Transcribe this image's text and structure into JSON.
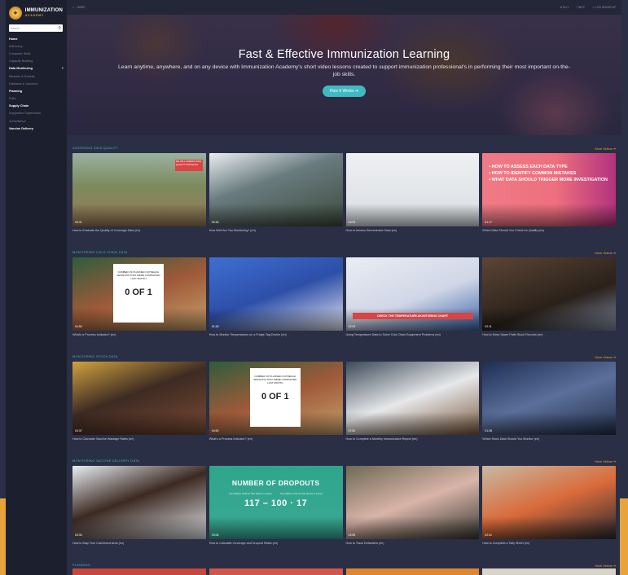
{
  "brand": {
    "name": "IMMUNIZATION",
    "sub": "ACADEMY"
  },
  "search": {
    "placeholder": "Search"
  },
  "nav": [
    {
      "label": "Home",
      "style": "bright"
    },
    {
      "label": "Advocacy",
      "style": "sub"
    },
    {
      "label": "Computer Skills",
      "style": "sub"
    },
    {
      "label": "Capacity Building",
      "style": "sub"
    },
    {
      "label": "Data Monitoring",
      "style": "bright",
      "plus": "+"
    },
    {
      "label": "Measles & Rubella",
      "style": "sub"
    },
    {
      "label": "Diseases & Vaccines",
      "style": "sub"
    },
    {
      "label": "Planning",
      "style": "bright"
    },
    {
      "label": "Polio",
      "style": "sub"
    },
    {
      "label": "Supply Chain",
      "style": "bright"
    },
    {
      "label": "Supportive Supervision",
      "style": "sub"
    },
    {
      "label": "Surveillance",
      "style": "sub"
    },
    {
      "label": "Vaccine Delivery",
      "style": "bright"
    }
  ],
  "topbar": {
    "crumb": "HOME",
    "lang": "EN",
    "help": "HELP",
    "login": "LOG IN/SIGN UP"
  },
  "hero": {
    "title": "Fast & Effective Immunization Learning",
    "text": "Learn anytime, anywhere, and on any device with Immunization Academy's short video lessons created to support immunization professional's in performing their most important on-the-job skills.",
    "button": "How It Works ➔"
  },
  "more_label": "More Videos ➔",
  "sections": [
    {
      "title": "ASSESSING DATA QUALITY",
      "cards": [
        {
          "duration": "03:31",
          "caption": "How to Evaluate the Quality of Coverage Data (en)",
          "tag": "WE WILL ASSESS DATA QUALITY FOR EACH"
        },
        {
          "duration": "02:26",
          "caption": "How Well Are You Monitoring? (en)"
        },
        {
          "duration": "03:03",
          "caption": "How to Assess Denominator Data (en)"
        },
        {
          "duration": "01:17",
          "caption": "Which Data Should You Check for Quality (en)",
          "bullets": [
            "• HOW TO ASSESS EACH DATA TYPE",
            "• HOW TO IDENTIFY COMMON MISTAKES",
            "• WHAT DATA SHOULD TRIGGER MORE INVESTIGATION"
          ]
        }
      ]
    },
    {
      "title": "MONITORING COLD CHAIN DATA",
      "cards": [
        {
          "duration": "04:50",
          "caption": "What's a Process Indicator? (en)",
          "slate_small": "NUMBER OF PLANNED OUTREACH SESSIONS THAT WERE COMPLETED LAST MONTH",
          "slate_big": "0 OF 1"
        },
        {
          "duration": "01:26",
          "caption": "How to Monitor Temperatures on a Fridge-Tag Device (en)"
        },
        {
          "duration": "02:09",
          "caption": "Using Temperature Data to Solve Cold Chain Equipment Problems (en)",
          "banner": "CHECK THE TEMPERATURE-MONITORING CHART"
        },
        {
          "duration": "02:11",
          "caption": "How to Keep Spare Parts Stock Records (en)"
        }
      ]
    },
    {
      "title": "MONITORING STOCK DATA",
      "cards": [
        {
          "duration": "04:37",
          "caption": "How to Calculate Vaccine Wastage Rates (en)"
        },
        {
          "duration": "04:50",
          "caption": "What's a Process Indicator? (en)",
          "slate_small": "NUMBER OF PLANNED OUTREACH SESSIONS THAT WERE COMPLETED LAST MONTH",
          "slate_big": "0 OF 1"
        },
        {
          "duration": "07:52",
          "caption": "How to Complete a Monthly Immunization Report (en)"
        },
        {
          "duration": "01:28",
          "caption": "Which Stock Data Should You Monitor (en)"
        }
      ]
    },
    {
      "title": "MONITORING VACCINE DELIVERY DATA",
      "cards": [
        {
          "duration": "03:34",
          "caption": "How to Map Your Catchment Area (en)"
        },
        {
          "duration": "03:06",
          "caption": "How to Calculate Coverage and Dropout Rates (en)",
          "formula": {
            "title": "NUMBER OF DROPOUTS",
            "left": "Cumulative total for first doses in series",
            "right": "Cumulative total for last doses in series",
            "eq": "117 – 100 · 17"
          }
        },
        {
          "duration": "02:55",
          "caption": "How to Track Defaulters (en)"
        },
        {
          "duration": "02:41",
          "caption": "How to Complete a Tally Sheet (en)"
        }
      ]
    },
    {
      "title": "PLANNING",
      "cards": []
    }
  ],
  "colors": {
    "accent": "#3fbac2",
    "more": "#e8a43a",
    "bg": "#2b2f45",
    "sidebar": "#1c1f2e"
  }
}
